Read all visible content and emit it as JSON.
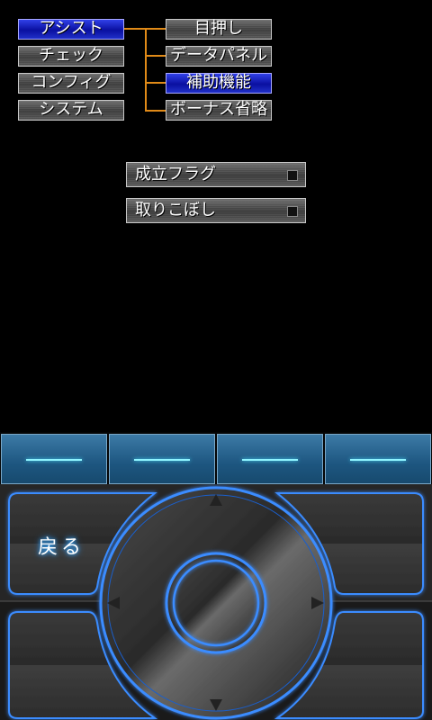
{
  "menu": {
    "main_items": [
      "アシスト",
      "チェック",
      "コンフィグ",
      "システム"
    ],
    "sub_items": [
      "目押し",
      "データパネル",
      "補助機能",
      "ボーナス省略"
    ],
    "selected_main": "アシスト",
    "selected_sub": "補助機能"
  },
  "options": [
    {
      "label": "成立フラグ"
    },
    {
      "label": "取りこぼし"
    }
  ],
  "controller": {
    "back_label": "戻る"
  },
  "colors": {
    "tree_line": "#e08a18",
    "selected": "#0a10a0",
    "neon": "#3a8cff",
    "top_dash": "#8ff4ff"
  }
}
